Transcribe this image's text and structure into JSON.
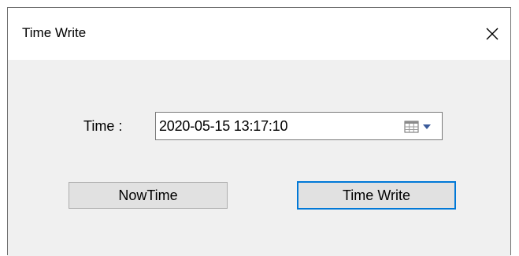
{
  "window": {
    "title": "Time Write",
    "close_icon": "close-icon"
  },
  "form": {
    "time_label": "Time :",
    "time_value": "2020-05-15 13:17:10",
    "dropdown_icon": "calendar-dropdown-icon"
  },
  "buttons": {
    "now_time_label": "NowTime",
    "time_write_label": "Time Write"
  },
  "colors": {
    "dialog_background": "#f0f0f0",
    "title_bar": "#ffffff",
    "button_face": "#e1e1e1",
    "focus_accent": "#0078d7"
  }
}
